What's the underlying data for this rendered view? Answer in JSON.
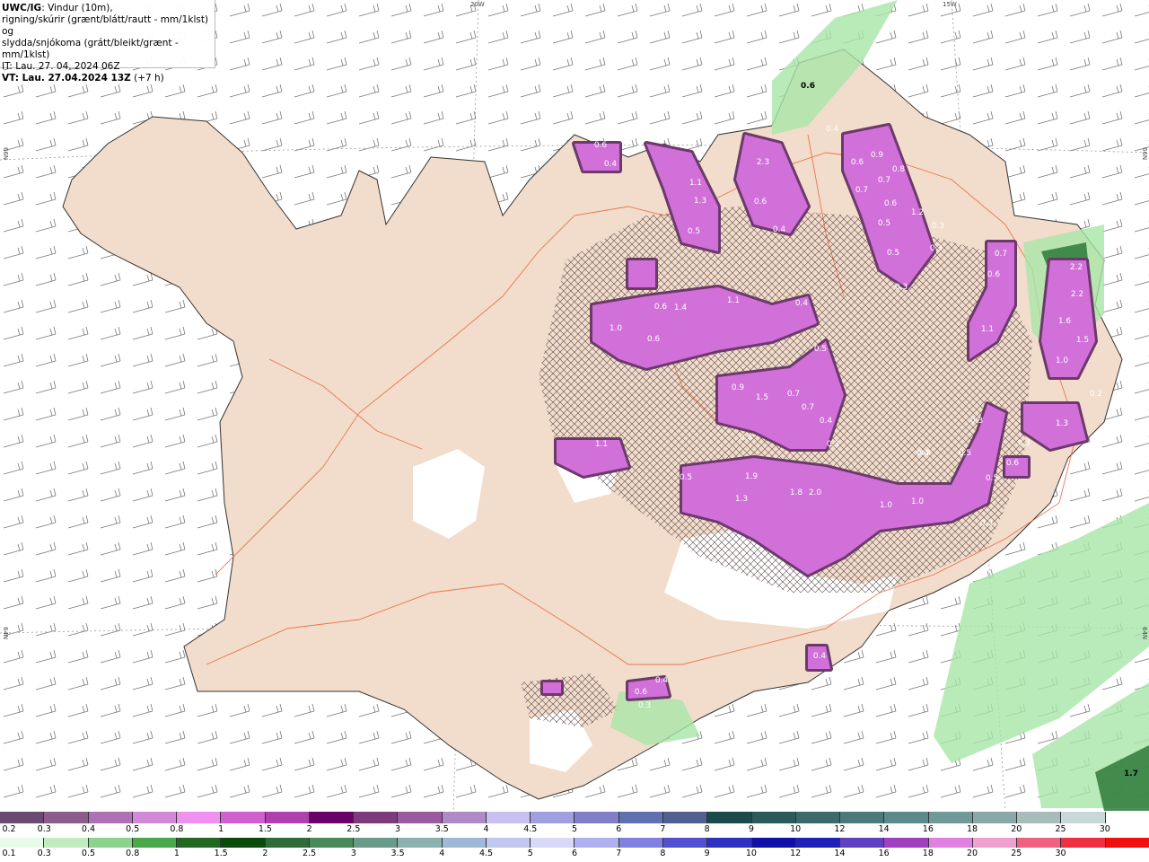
{
  "title": {
    "model": "UWC/IG",
    "line1_rest": ": Vindur (10m),",
    "line2": "rigning/skúrir (grænt/blátt/rautt - mm/1klst) og",
    "line3": "slydda/snjókoma (grátt/bleikt/grænt - mm/1klst)",
    "it": "IT: Lau. 27. 04. 2024 06Z",
    "vt_bold": "VT: Lau. 27.04.2024 13Z",
    "vt_rest": " (+7 h)"
  },
  "grid_labels": {
    "lon_20w": "20W",
    "lon_15w": "15W",
    "lat_66n_left": "66N",
    "lat_66n_right": "66N",
    "lat_64n_left": "64N",
    "lat_64n_right": "64N"
  },
  "precip_values": [
    {
      "v": "0.6",
      "dark": true
    },
    {
      "v": "0.6",
      "dark": false
    },
    {
      "v": "0.4"
    },
    {
      "v": "1.1"
    },
    {
      "v": "1.3"
    },
    {
      "v": "0.5"
    },
    {
      "v": "2.3"
    },
    {
      "v": "0.6"
    },
    {
      "v": "0.4"
    },
    {
      "v": "0.4"
    },
    {
      "v": "0.6"
    },
    {
      "v": "0.9"
    },
    {
      "v": "0.8"
    },
    {
      "v": "0.7"
    },
    {
      "v": "0.7"
    },
    {
      "v": "0.6"
    },
    {
      "v": "1.2"
    },
    {
      "v": "0.3"
    },
    {
      "v": "0.5"
    },
    {
      "v": "0.3"
    },
    {
      "v": "0.5"
    },
    {
      "v": "0.3"
    },
    {
      "v": "0.7"
    },
    {
      "v": "0.6"
    },
    {
      "v": "2.2"
    },
    {
      "v": "2.2"
    },
    {
      "v": "1.6"
    },
    {
      "v": "1.5"
    },
    {
      "v": "1.0"
    },
    {
      "v": "1.1"
    },
    {
      "v": "1.0"
    },
    {
      "v": "1.4"
    },
    {
      "v": "0.6"
    },
    {
      "v": "0.6"
    },
    {
      "v": "1.1"
    },
    {
      "v": "0.4"
    },
    {
      "v": "0.5"
    },
    {
      "v": "0.9"
    },
    {
      "v": "1.5"
    },
    {
      "v": "0.7"
    },
    {
      "v": "0.7"
    },
    {
      "v": "0.4"
    },
    {
      "v": "0.4"
    },
    {
      "v": "0.3"
    },
    {
      "v": "0.4"
    },
    {
      "v": "1.1"
    },
    {
      "v": "0.5"
    },
    {
      "v": "1.9"
    },
    {
      "v": "1.3"
    },
    {
      "v": "1.8"
    },
    {
      "v": "2.0"
    },
    {
      "v": "1.0"
    },
    {
      "v": "1.0"
    },
    {
      "v": "0.6"
    },
    {
      "v": "1.3"
    },
    {
      "v": "0.5"
    },
    {
      "v": "0.3"
    },
    {
      "v": "0.5"
    },
    {
      "v": "0.3"
    },
    {
      "v": "0.4"
    },
    {
      "v": "0.6"
    },
    {
      "v": "0.4"
    },
    {
      "v": "0.3"
    },
    {
      "v": "0.4"
    },
    {
      "v": "1.7",
      "dark": true
    },
    {
      "v": "0.3"
    },
    {
      "v": "0.2"
    }
  ],
  "scale_top": {
    "colors": [
      "#6b4a72",
      "#8b5c8c",
      "#b070b8",
      "#d28ad8",
      "#f090f0",
      "#d060d0",
      "#b040b0",
      "#6a006a",
      "#7d3a7d",
      "#9a5aa0",
      "#b08ac8",
      "#c8c0f0",
      "#a0a0e0",
      "#8080c8",
      "#6070b0",
      "#506090",
      "#1a4a4a",
      "#2a5a5a",
      "#3a6a6a",
      "#4a7a7a",
      "#5a8a8a",
      "#709a9a",
      "#8aa8aa",
      "#a8bcbc",
      "#c8d8d8",
      "#ffffff"
    ],
    "ticks": [
      "0.2",
      "0.3",
      "0.4",
      "0.5",
      "0.8",
      "1",
      "1.5",
      "2",
      "2.5",
      "3",
      "3.5",
      "4",
      "4.5",
      "5",
      "6",
      "7",
      "8",
      "9",
      "10",
      "12",
      "14",
      "16",
      "18",
      "20",
      "25",
      "30"
    ]
  },
  "scale_bottom": {
    "colors": [
      "#e8fae8",
      "#c0ecc0",
      "#8cd48c",
      "#4aa84a",
      "#206820",
      "#0a4a0a",
      "#2e6a3a",
      "#4a8a5a",
      "#6a9a8a",
      "#8ab0b0",
      "#a0b8d8",
      "#c0c8f0",
      "#d8d8f8",
      "#b0b0f0",
      "#8080e0",
      "#5050d0",
      "#3030c0",
      "#1010a8",
      "#2020b8",
      "#6040c0",
      "#a040c0",
      "#e080e0",
      "#f0a0d0",
      "#f06080",
      "#f03040",
      "#f01010"
    ],
    "ticks": [
      "0.1",
      "0.3",
      "0.5",
      "0.8",
      "1",
      "1.5",
      "2",
      "2.5",
      "3",
      "3.5",
      "4",
      "4.5",
      "5",
      "6",
      "7",
      "8",
      "9",
      "10",
      "12",
      "14",
      "16",
      "18",
      "20",
      "25",
      "30"
    ]
  }
}
